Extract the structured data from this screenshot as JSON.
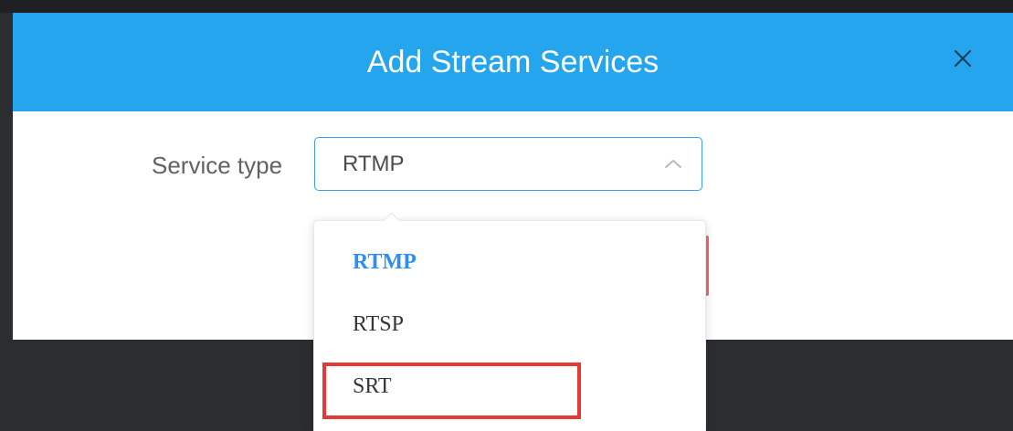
{
  "dialog": {
    "title": "Add Stream Services",
    "close_icon": "close-icon"
  },
  "form": {
    "service_type_label": "Service type",
    "service_type_value": "RTMP",
    "toggle_icon": "chevron-up-icon"
  },
  "dropdown": {
    "options": [
      {
        "label": "RTMP",
        "selected": true
      },
      {
        "label": "RTSP",
        "selected": false
      },
      {
        "label": "SRT",
        "selected": false
      }
    ]
  },
  "annotation": {
    "highlighted_option": "SRT",
    "highlight_color": "#e53935"
  },
  "colors": {
    "header": "#26a5ef",
    "accent": "#3d9cf0",
    "selected_option": "#2c8ef3"
  }
}
